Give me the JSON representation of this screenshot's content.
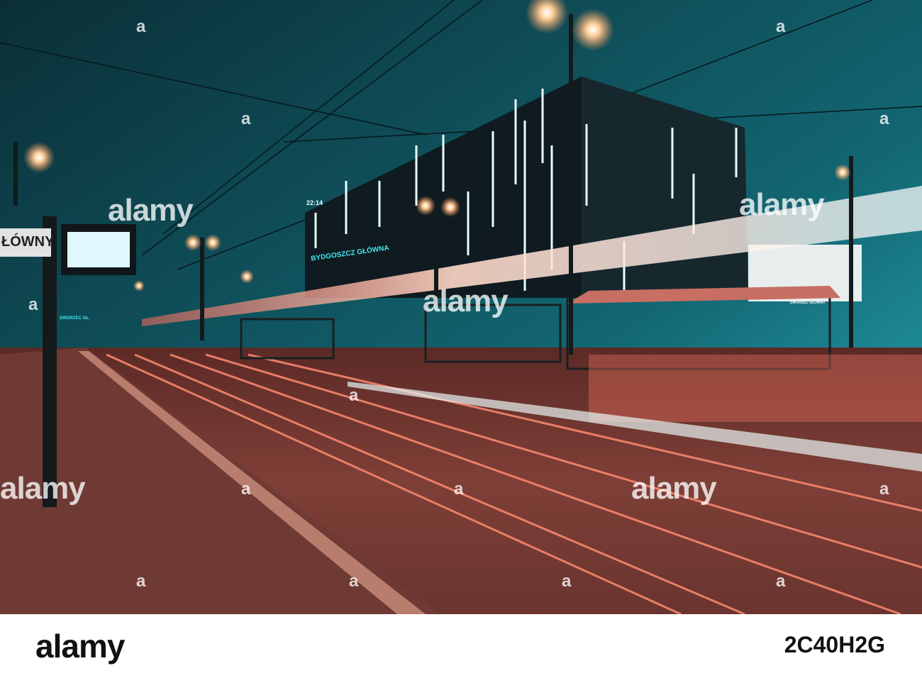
{
  "watermark": {
    "text": "alamy",
    "mark": "a"
  },
  "signs": {
    "stop_sign": "ŁÓWNY",
    "building_sign": "BYDGOSZCZ GŁÓWNA",
    "building_clock": "22:14",
    "station_sign": "DWORZEC GŁ.",
    "shelter_sign": "DWORZEC GŁÓWNY"
  },
  "footer": {
    "logo": "alamy",
    "image_id": "2C40H2G"
  }
}
